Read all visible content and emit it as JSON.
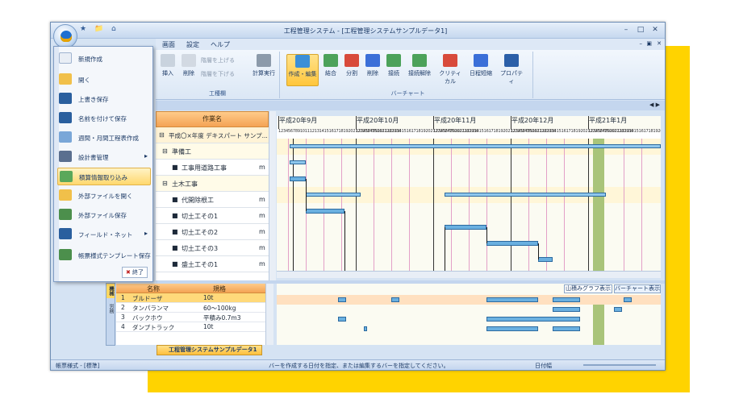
{
  "window": {
    "title": "工程管理システム - [工程管理システムサンプルデータ1]"
  },
  "menubar": {
    "items": [
      "画面",
      "設定",
      "ヘルプ"
    ]
  },
  "ribbon": {
    "groups": [
      {
        "label": "工種欄",
        "buttons": [
          "挿入",
          "削除",
          "階層を上げる",
          "階層を下げる",
          "計算実行"
        ]
      },
      {
        "label": "バーチャート",
        "buttons": [
          "作成・編集",
          "結合",
          "分割",
          "削除",
          "接続",
          "接続解除",
          "クリティカル",
          "日程短縮",
          "プロパティ"
        ]
      }
    ]
  },
  "filemenu": {
    "items": [
      "新規作成",
      "開く",
      "上書き保存",
      "名前を付けて保存",
      "週間・月間工程表作成",
      "設計書管理",
      "積算情報取り込み",
      "外部ファイルを開く",
      "外部ファイル保存",
      "フィールド・ネット",
      "帳票様式テンプレート保存"
    ],
    "exit_label": "終了"
  },
  "task_table": {
    "header": "作業名",
    "rows": [
      {
        "label": "平成〇×年度 デキスパート サンプ..."
      },
      {
        "label": "準備工"
      },
      {
        "label": "工事用道路工事",
        "unit": "m"
      },
      {
        "label": "土木工事"
      },
      {
        "label": "代開除根工",
        "unit": "m"
      },
      {
        "label": "切土工その1",
        "unit": "m"
      },
      {
        "label": "切土工その2",
        "unit": "m"
      },
      {
        "label": "切土工その3",
        "unit": "m"
      },
      {
        "label": "盛土工その1",
        "unit": "m"
      }
    ]
  },
  "gantt": {
    "months": [
      "平成20年9月",
      "平成20年10月",
      "平成20年11月",
      "平成20年12月",
      "平成21年1月"
    ],
    "day_numbers": "123456789101112131415161718192021222324252627282930"
  },
  "resource_table": {
    "side_tabs": [
      "機械",
      "労務"
    ],
    "headers": {
      "name": "名称",
      "spec": "規格"
    },
    "rows": [
      {
        "no": "1",
        "name": "ブルドーザ",
        "spec": "10t"
      },
      {
        "no": "2",
        "name": "タンパランマ",
        "spec": "60～100kg"
      },
      {
        "no": "3",
        "name": "バックホウ",
        "spec": "平積み0.7m3"
      },
      {
        "no": "4",
        "name": "ダンプトラック",
        "spec": "10t"
      }
    ]
  },
  "lower_buttons": {
    "mountain": "山積みグラフ表示",
    "bar": "バーチャート表示"
  },
  "doc_tab": "工程管理システムサンプルデータ1",
  "status": {
    "left": "帳票様式 - [標準]",
    "center": "バーを作成する日付を指定、または編集するバーを指定してください。",
    "right": "日付幅"
  }
}
